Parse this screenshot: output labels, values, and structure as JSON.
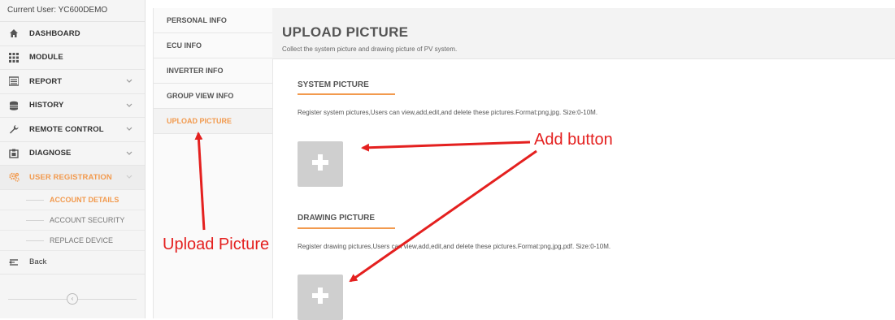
{
  "sidebar": {
    "current_user": "Current User: YC600DEMO",
    "items": [
      {
        "label": "DASHBOARD",
        "icon": "home-icon",
        "has_chevron": false
      },
      {
        "label": "MODULE",
        "icon": "grid-icon",
        "has_chevron": false
      },
      {
        "label": "REPORT",
        "icon": "report-icon",
        "has_chevron": true
      },
      {
        "label": "HISTORY",
        "icon": "database-icon",
        "has_chevron": true
      },
      {
        "label": "REMOTE CONTROL",
        "icon": "wrench-icon",
        "has_chevron": true
      },
      {
        "label": "DIAGNOSE",
        "icon": "diagnose-icon",
        "has_chevron": true
      },
      {
        "label": "USER REGISTRATION",
        "icon": "gears-icon",
        "has_chevron": true
      }
    ],
    "sub_items": [
      "ACCOUNT DETAILS",
      "ACCOUNT SECURITY",
      "REPLACE DEVICE"
    ],
    "back_label": "Back"
  },
  "tabs": [
    "PERSONAL INFO",
    "ECU INFO",
    "INVERTER INFO",
    "GROUP VIEW INFO",
    "UPLOAD PICTURE"
  ],
  "main": {
    "title": "UPLOAD PICTURE",
    "subtitle": "Collect the system picture and drawing picture of PV system.",
    "system": {
      "title": "SYSTEM PICTURE",
      "desc": "Register system pictures,Users can view,add,edit,and delete these pictures.Format:png,jpg. Size:0-10M."
    },
    "drawing": {
      "title": "DRAWING PICTURE",
      "desc": "Register drawing pictures,Users can view,add,edit,and delete these pictures.Format:png,jpg,pdf. Size:0-10M."
    }
  },
  "annotations": {
    "upload_picture": "Upload Picture",
    "add_button": "Add button"
  },
  "colors": {
    "accent": "#f29a4e",
    "annotation": "#e4201f",
    "add_button_bg": "#cfcfcf"
  }
}
